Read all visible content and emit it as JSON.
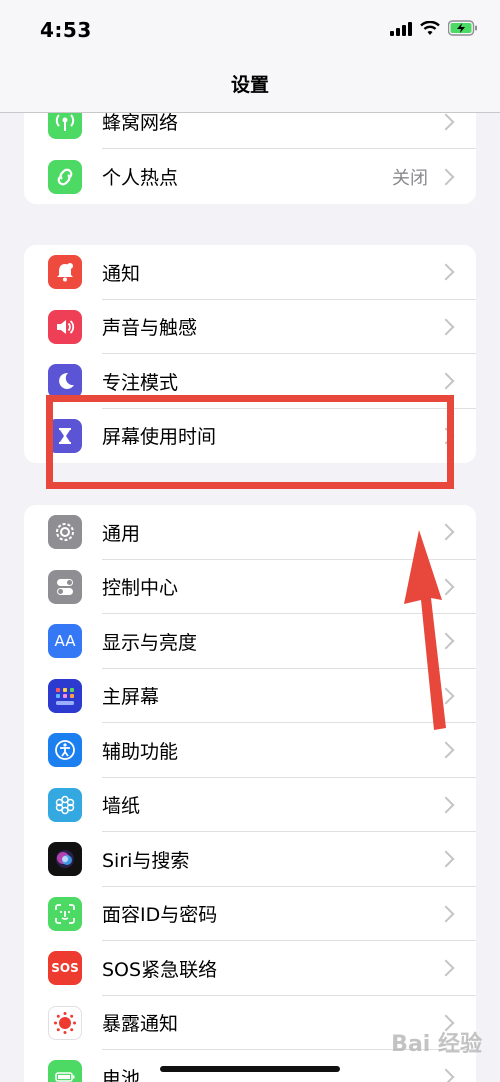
{
  "status": {
    "time": "4:53"
  },
  "nav": {
    "title": "设置"
  },
  "group1": [
    {
      "name": "cellular",
      "label": "蜂窝网络",
      "value": "",
      "color": "#4cd964",
      "icon": "antenna-icon"
    },
    {
      "name": "hotspot",
      "label": "个人热点",
      "value": "关闭",
      "color": "#4cd964",
      "icon": "link-icon"
    }
  ],
  "group2": [
    {
      "name": "notifications",
      "label": "通知",
      "color": "#ee4a3d",
      "icon": "bell-icon"
    },
    {
      "name": "sounds",
      "label": "声音与触感",
      "color": "#ee3f57",
      "icon": "speaker-icon"
    },
    {
      "name": "focus",
      "label": "专注模式",
      "color": "#5b55d6",
      "icon": "moon-icon"
    },
    {
      "name": "screen-time",
      "label": "屏幕使用时间",
      "color": "#5b55d6",
      "icon": "hourglass-icon"
    }
  ],
  "group3": [
    {
      "name": "general",
      "label": "通用",
      "color": "#8e8e93",
      "icon": "gear-icon"
    },
    {
      "name": "control-center",
      "label": "控制中心",
      "color": "#8e8e93",
      "icon": "toggles-icon"
    },
    {
      "name": "display",
      "label": "显示与亮度",
      "color": "#3478f6",
      "icon": "text-size-icon",
      "glyph": "AA"
    },
    {
      "name": "home-screen",
      "label": "主屏幕",
      "color": "#3d4fd9",
      "icon": "app-grid-icon"
    },
    {
      "name": "accessibility",
      "label": "辅助功能",
      "color": "#1c7ff0",
      "icon": "accessibility-icon"
    },
    {
      "name": "wallpaper",
      "label": "墙纸",
      "color": "#34a8e0",
      "icon": "flower-icon"
    },
    {
      "name": "siri",
      "label": "Siri与搜索",
      "color": "#1a1a2e",
      "icon": "siri-icon"
    },
    {
      "name": "face-id",
      "label": "面容ID与密码",
      "color": "#4cd964",
      "icon": "face-id-icon"
    },
    {
      "name": "sos",
      "label": "SOS紧急联络",
      "color": "#ee3b30",
      "icon": "sos-icon",
      "glyph": "SOS"
    },
    {
      "name": "exposure",
      "label": "暴露通知",
      "color": "#ffffff",
      "icon": "exposure-icon"
    },
    {
      "name": "battery",
      "label": "电池",
      "color": "#4cd964",
      "icon": "battery-icon"
    }
  ],
  "watermark": "Bai 经验"
}
